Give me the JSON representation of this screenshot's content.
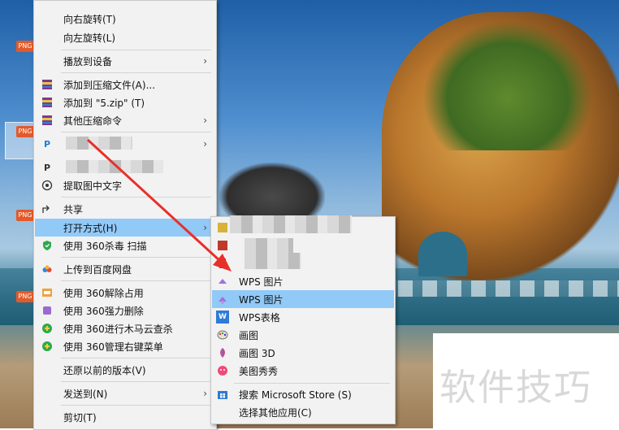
{
  "main_menu": {
    "items": [
      {
        "label": "向右旋转(T)"
      },
      {
        "label": "向左旋转(L)"
      },
      {
        "label": "播放到设备"
      },
      {
        "label": "添加到压缩文件(A)..."
      },
      {
        "label": "添加到 \"5.zip\" (T)"
      },
      {
        "label": "其他压缩命令"
      },
      {
        "label": "提取图中文字"
      },
      {
        "label": "共享"
      },
      {
        "label": "打开方式(H)"
      },
      {
        "label": "使用 360杀毒 扫描"
      },
      {
        "label": "上传到百度网盘"
      },
      {
        "label": "使用 360解除占用"
      },
      {
        "label": "使用 360强力删除"
      },
      {
        "label": "使用 360进行木马云查杀"
      },
      {
        "label": "使用 360管理右键菜单"
      },
      {
        "label": "还原以前的版本(V)"
      },
      {
        "label": "发送到(N)"
      },
      {
        "label": "剪切(T)"
      }
    ]
  },
  "sub_menu": {
    "items": [
      {
        "label": "WPS 图片"
      },
      {
        "label": "WPS 图片"
      },
      {
        "label": "WPS表格"
      },
      {
        "label": "画图"
      },
      {
        "label": "画图 3D"
      },
      {
        "label": "美图秀秀"
      },
      {
        "label": "搜索 Microsoft Store (S)"
      },
      {
        "label": "选择其他应用(C)"
      }
    ]
  },
  "desktop": {
    "icon_badge": "PNG"
  },
  "watermark": {
    "text": "软件技巧"
  },
  "colors": {
    "highlight": "#91c9f7",
    "menu_bg": "#f2f2f2",
    "arrow": "#e8302a"
  },
  "icons": {
    "submenu_arrow": "chevron-right-icon",
    "archive": "winrar-icon",
    "pixiv_like": "p-icon",
    "ocr": "text-extract-icon",
    "share": "share-icon",
    "antivirus": "360-shield-icon",
    "cloud": "baidu-cloud-icon"
  }
}
